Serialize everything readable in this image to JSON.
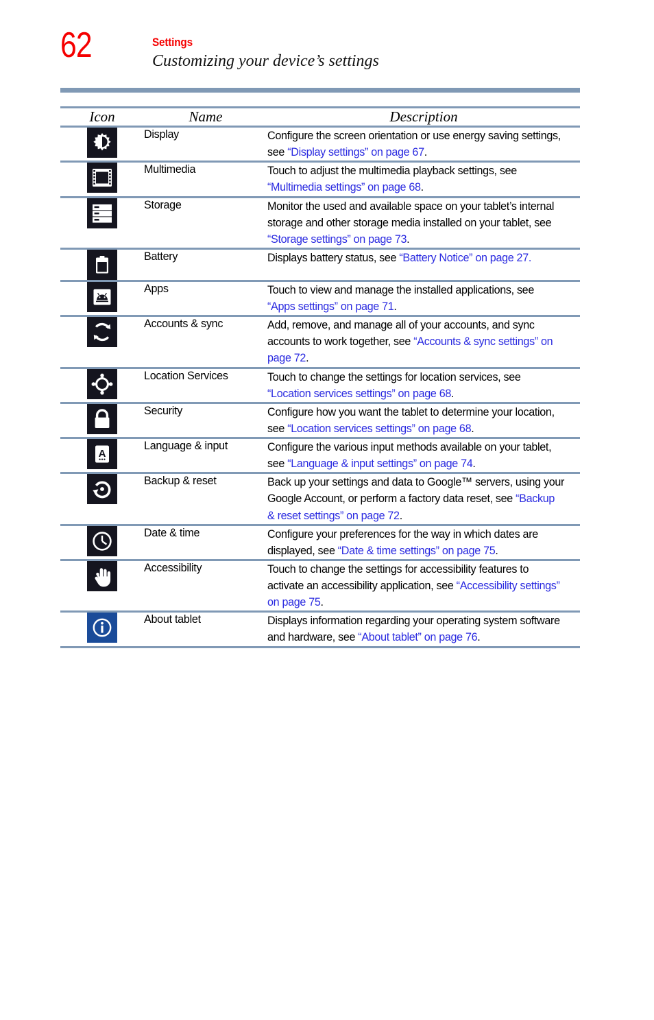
{
  "page": {
    "folio": "62",
    "chapter": "Settings",
    "section": "Customizing your device’s settings"
  },
  "colors": {
    "folio_red": "#f50000",
    "rule_blue_gray": "#8099b5",
    "link_blue": "#2a2ae0",
    "icon_tile_dark": "#15151f",
    "icon_tile_blue": "#1a4b99"
  },
  "table": {
    "headers": {
      "icon": "Icon",
      "name": "Name",
      "description": "Description"
    },
    "rows": [
      {
        "icon": "display-brightness-icon",
        "icon_style": "dark",
        "name": "Display",
        "desc_pre": "Configure the screen orientation or use energy saving settings, see ",
        "desc_link": "“Display settings” on page 67",
        "desc_post": "."
      },
      {
        "icon": "multimedia-filmstrip-icon",
        "icon_style": "dark",
        "name": "Multimedia",
        "desc_pre": "Touch to adjust the multimedia playback settings, see ",
        "desc_link": "“Multimedia settings” on page 68",
        "desc_post": "."
      },
      {
        "icon": "storage-drives-icon",
        "icon_style": "dark",
        "name": "Storage",
        "desc_pre": "Monitor the used and available space on your tablet’s internal storage and other storage media installed on your tablet, see ",
        "desc_link": "“Storage settings” on page 73",
        "desc_post": "."
      },
      {
        "icon": "battery-icon",
        "icon_style": "dark",
        "name": "Battery",
        "desc_pre": "Displays battery status, see ",
        "desc_link": "“Battery Notice” on page 27.",
        "desc_post": ""
      },
      {
        "icon": "apps-android-icon",
        "icon_style": "dark",
        "name": "Apps",
        "desc_pre": "Touch to view and manage the installed applications, see ",
        "desc_link": "“Apps settings” on page 71",
        "desc_post": "."
      },
      {
        "icon": "accounts-sync-icon",
        "icon_style": "dark",
        "name": "Accounts & sync",
        "desc_pre": "Add, remove, and manage all of your accounts, and sync accounts to work together, see ",
        "desc_link": "“Accounts & sync settings” on page 72",
        "desc_post": "."
      },
      {
        "icon": "location-crosshair-icon",
        "icon_style": "dark",
        "name": "Location Services",
        "desc_pre": "Touch to change the settings for location services, see ",
        "desc_link": "“Location services settings” on page 68",
        "desc_post": "."
      },
      {
        "icon": "security-lock-icon",
        "icon_style": "dark",
        "name": "Security",
        "desc_pre": "Configure how you want the tablet to determine your location, see ",
        "desc_link": "“Location services settings” on page 68",
        "desc_post": "."
      },
      {
        "icon": "language-input-icon",
        "icon_style": "dark",
        "name": "Language & input",
        "desc_pre": "Configure the various input methods available on your tablet, see ",
        "desc_link": "“Language & input settings” on page 74",
        "desc_post": "."
      },
      {
        "icon": "backup-reset-icon",
        "icon_style": "dark",
        "name": "Backup & reset",
        "desc_pre": "Back up your settings and data to Google™ servers, using your Google Account, or perform a factory data reset, see ",
        "desc_link": "“Backup & reset settings” on page 72",
        "desc_post": "."
      },
      {
        "icon": "date-time-clock-icon",
        "icon_style": "dark",
        "name": "Date & time",
        "desc_pre": "Configure your preferences for the way in which dates are displayed, see ",
        "desc_link": "“Date & time settings” on page 75",
        "desc_post": "."
      },
      {
        "icon": "accessibility-hand-icon",
        "icon_style": "dark",
        "name": "Accessibility",
        "desc_pre": "Touch to change the settings for accessibility features to activate an accessibility application, see ",
        "desc_link": "“Accessibility settings” on page 75",
        "desc_post": "."
      },
      {
        "icon": "about-info-icon",
        "icon_style": "blue",
        "name": "About tablet",
        "desc_pre": "Displays information regarding your operating system software and hardware, see ",
        "desc_link": "“About tablet” on page 76",
        "desc_post": "."
      }
    ]
  }
}
